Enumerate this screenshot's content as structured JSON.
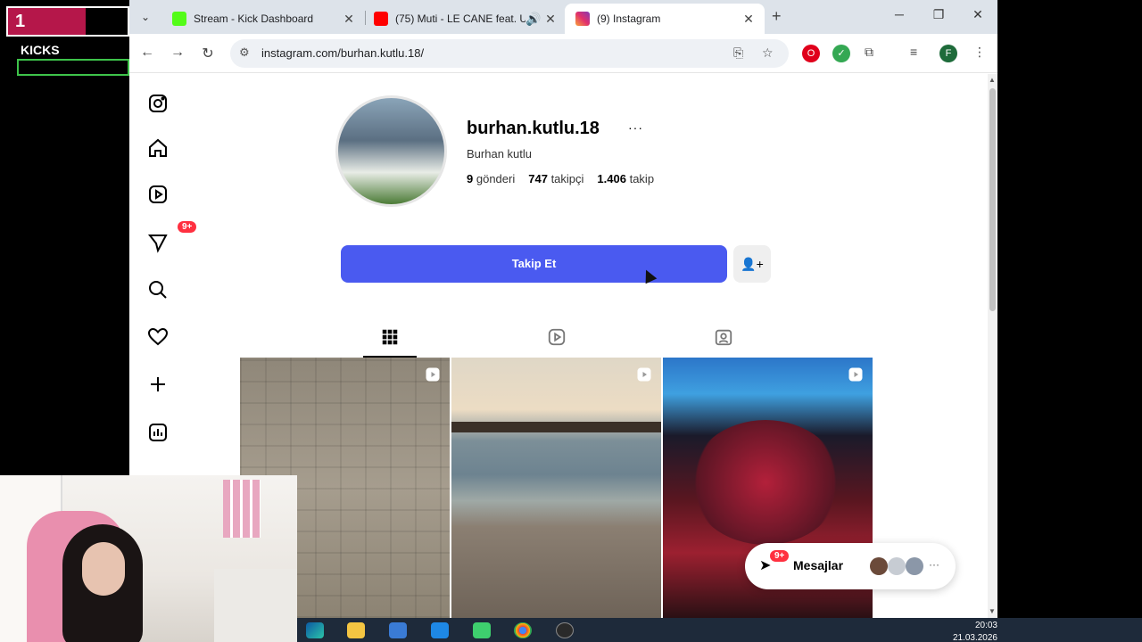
{
  "overlay": {
    "counter": "1",
    "kicks_label": "KICKS",
    "counter_fill_fraction": 0.65
  },
  "browser": {
    "tabs": [
      {
        "title": "Stream - Kick Dashboard",
        "favicon_color": "#53fc18",
        "active": false
      },
      {
        "title": "(75) Muti - LE CANE feat. U",
        "favicon_color": "#ff0000",
        "active": false,
        "audio": true
      },
      {
        "title": "(9) Instagram",
        "favicon_color": "#e1306c",
        "active": true
      }
    ],
    "url": "instagram.com/burhan.kutlu.18/",
    "profile_initial": "F"
  },
  "instagram": {
    "nav_icons": [
      "instagram-icon",
      "home-icon",
      "reels-icon",
      "messages-icon",
      "search-icon",
      "heart-icon",
      "create-icon",
      "dashboard-icon"
    ],
    "messages_badge": "9+",
    "username": "burhan.kutlu.18",
    "full_name": "Burhan kutlu",
    "stats": {
      "posts_count": "9",
      "posts_label": "gönderi",
      "followers_count": "747",
      "followers_label": "takipçi",
      "following_count": "1.406",
      "following_label": "takip"
    },
    "follow_button": "Takip Et",
    "messages_panel": {
      "label": "Mesajlar",
      "badge": "9+"
    }
  },
  "taskbar": {
    "time": "20:03",
    "date": "21.03.2026"
  },
  "colors": {
    "follow_blue": "#4a5af0",
    "badge_red": "#ff3040",
    "overlay_magenta": "#b5174a",
    "overlay_green": "#3ec34a"
  }
}
